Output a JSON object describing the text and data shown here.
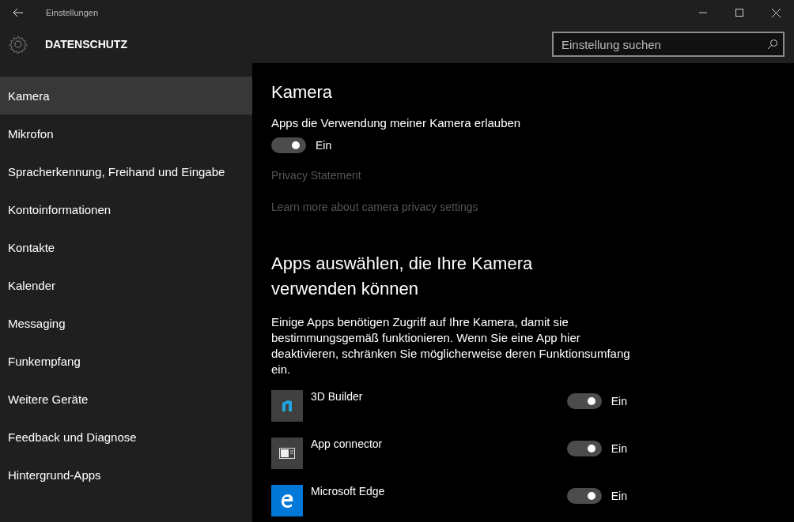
{
  "window": {
    "title": "Einstellungen"
  },
  "header": {
    "title": "DATENSCHUTZ",
    "search": {
      "placeholder": "Einstellung suchen"
    }
  },
  "sidebar": {
    "items": [
      {
        "label": "Kamera",
        "selected": true
      },
      {
        "label": "Mikrofon",
        "selected": false
      },
      {
        "label": "Spracherkennung, Freihand und Eingabe",
        "selected": false
      },
      {
        "label": "Kontoinformationen",
        "selected": false
      },
      {
        "label": "Kontakte",
        "selected": false
      },
      {
        "label": "Kalender",
        "selected": false
      },
      {
        "label": "Messaging",
        "selected": false
      },
      {
        "label": "Funkempfang",
        "selected": false
      },
      {
        "label": "Weitere Geräte",
        "selected": false
      },
      {
        "label": "Feedback und Diagnose",
        "selected": false
      },
      {
        "label": "Hintergrund-Apps",
        "selected": false
      }
    ]
  },
  "content": {
    "title": "Kamera",
    "master": {
      "label": "Apps die Verwendung meiner Kamera erlauben",
      "on": true,
      "state": "Ein"
    },
    "links": [
      "Privacy Statement",
      "Learn more about camera privacy settings"
    ],
    "apps_heading": "Apps auswählen, die Ihre Kamera verwenden können",
    "description": "Einige Apps benötigen Zugriff auf Ihre Kamera, damit sie bestimmungsgemäß funktionieren. Wenn Sie eine App hier deaktivieren, schränken Sie möglicherweise deren Funktionsumfang ein.",
    "apps": [
      {
        "name": "3D Builder",
        "kind": "builder",
        "color": "#404040",
        "on": true,
        "state": "Ein"
      },
      {
        "name": "App connector",
        "kind": "connector",
        "color": "#404040",
        "on": true,
        "state": "Ein"
      },
      {
        "name": "Microsoft Edge",
        "kind": "browser",
        "color": "#0078d7",
        "on": true,
        "state": "Ein"
      }
    ]
  }
}
